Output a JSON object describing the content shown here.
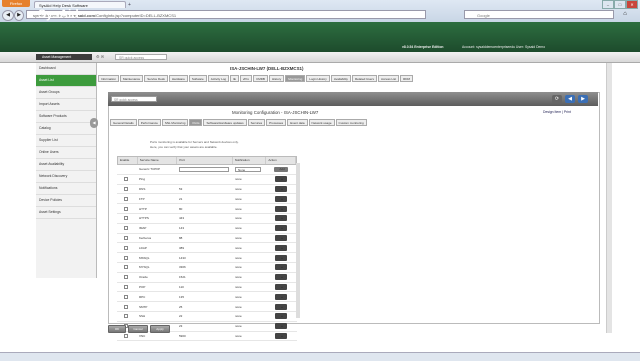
{
  "browser": {
    "app_button": "Firefox",
    "tab_title": "SysAid Help Desk Software",
    "new_tab": "+",
    "url_prefix": "sysaiddemoenterprise.",
    "url_host": "sysaid.com",
    "url_path": "/ConfigInfo.jsp?computerID=DELL-BZXMCS1",
    "search_placeholder": "Google",
    "win_min": "–",
    "win_max": "□",
    "win_close": "✕",
    "back": "◀",
    "forward": "▶",
    "home": "⌂"
  },
  "header": {
    "logo": "SysAid",
    "edition": "v8.0.54 Enterprise Edition",
    "account": "Account: sysaiddemoenterpriseedu  User: Sysaid Demo"
  },
  "toolbar": {
    "module": "Asset Management",
    "quick_access": "SR quick access",
    "design_print": "Design Item | Print"
  },
  "sidebar": {
    "items": [
      {
        "label": "Dashboard"
      },
      {
        "label": "Asset List"
      },
      {
        "label": "Asset Groups"
      },
      {
        "label": "Import Assets"
      },
      {
        "label": "Software Products"
      },
      {
        "label": "Catalog"
      },
      {
        "label": "Supplier List"
      },
      {
        "label": "Online Users"
      },
      {
        "label": "Asset Availability"
      },
      {
        "label": "Network Discovery"
      },
      {
        "label": "Notifications"
      },
      {
        "label": "Device Policies"
      },
      {
        "label": "Asset Settings"
      }
    ],
    "active_index": 1,
    "collapse": "◀"
  },
  "asset": {
    "title": "ISA-JSCHIN-LW7 (DELL-BZXMCS1)",
    "tabs": [
      "Information",
      "Maintenance",
      "Service Desk",
      "Hardware",
      "Software",
      "Activity Log",
      "IE",
      "vPro",
      "CMDB",
      "History",
      "Monitoring",
      "Login History",
      "Availability",
      "Related Users",
      "Access List",
      "RDM"
    ],
    "active_tab": "Monitoring"
  },
  "inner": {
    "quick_access": "SR quick access",
    "title": "Monitoring Configuration - ISA-JSCHIN-LW7",
    "design_print": "Design Item | Print",
    "tabs": [
      "General Details",
      "Performance",
      "SNL Monitoring",
      "Ports",
      "Software/Hardware updates",
      "Services",
      "Processes",
      "Event data",
      "Network usage",
      "Custom monitoring"
    ],
    "active_tab": "Ports",
    "note_line1": "Ports monitoring is available for Servers and Network devices only.",
    "note_line2": "Here, you can verify that your assets are available."
  },
  "ports_table": {
    "headers": [
      "Enable",
      "Service Name",
      "Port",
      "Notification",
      "Action"
    ],
    "custom_row": {
      "name": "Generic TCPIIP",
      "notification": "None",
      "add_label": "Add"
    },
    "rows": [
      {
        "name": "Ping",
        "port": "",
        "notification": "none"
      },
      {
        "name": "DNS",
        "port": "53",
        "notification": "none"
      },
      {
        "name": "FTP",
        "port": "21",
        "notification": "none"
      },
      {
        "name": "HTTP",
        "port": "80",
        "notification": "none"
      },
      {
        "name": "HTTPS",
        "port": "443",
        "notification": "none"
      },
      {
        "name": "IMAP",
        "port": "143",
        "notification": "none"
      },
      {
        "name": "Kerberos",
        "port": "88",
        "notification": "none"
      },
      {
        "name": "LDAP",
        "port": "389",
        "notification": "none"
      },
      {
        "name": "MSSQL",
        "port": "1433",
        "notification": "none"
      },
      {
        "name": "MYSQL",
        "port": "3306",
        "notification": "none"
      },
      {
        "name": "Oracle",
        "port": "1521",
        "notification": "none"
      },
      {
        "name": "POP",
        "port": "110",
        "notification": "none"
      },
      {
        "name": "RPC",
        "port": "135",
        "notification": "none"
      },
      {
        "name": "SMTP",
        "port": "25",
        "notification": "none"
      },
      {
        "name": "SSH",
        "port": "22",
        "notification": "none"
      },
      {
        "name": "Telnet",
        "port": "23",
        "notification": "none"
      },
      {
        "name": "VNC",
        "port": "5900",
        "notification": "none"
      }
    ],
    "action_icon": "▲"
  },
  "buttons": {
    "ok": "OK",
    "cancel": "Cancel",
    "apply": "Apply"
  },
  "colors": {
    "brand_green": "#2d6e40",
    "active_green": "#3d9b3d"
  }
}
